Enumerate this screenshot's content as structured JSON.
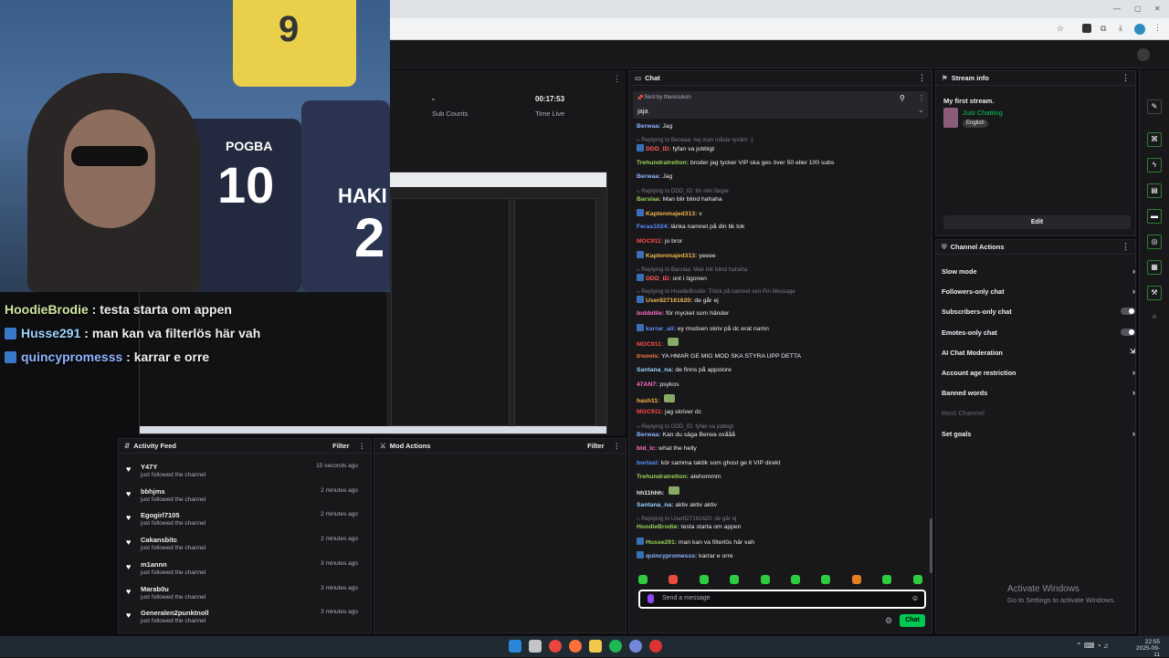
{
  "stats": {
    "subs_value": "-",
    "subs_label": "Sub Counts",
    "time_value": "00:17:53",
    "time_label": "Time Live"
  },
  "webcam": {
    "jersey_name_1": "POGBA",
    "jersey_num_1": "10",
    "jersey_name_2": "HAKI",
    "jersey_num_2": "2",
    "jersey_top_num": "9"
  },
  "overlay_chat": [
    {
      "user": "HoodieBrodie",
      "msg": ": testa starta om appen",
      "badge": false
    },
    {
      "user": "Husse291",
      "msg": ": man kan va filterlös här vah",
      "badge": true
    },
    {
      "user": "quincypromesss",
      "msg": ": karrar e orre",
      "badge": true
    }
  ],
  "activity": {
    "title": "Activity Feed",
    "filter": "Filter",
    "items": [
      {
        "name": "Y47Y",
        "action": "just followed the channel",
        "time": "15 seconds ago"
      },
      {
        "name": "bbhjms",
        "action": "just followed the channel",
        "time": "2 minutes ago"
      },
      {
        "name": "Egogirl7105",
        "action": "just followed the channel",
        "time": "2 minutes ago"
      },
      {
        "name": "Cakansbitc",
        "action": "just followed the channel",
        "time": "2 minutes ago"
      },
      {
        "name": "m1annn",
        "action": "just followed the channel",
        "time": "3 minutes ago"
      },
      {
        "name": "Marab0u",
        "action": "just followed the channel",
        "time": "3 minutes ago"
      },
      {
        "name": "Generalen2punktnoll",
        "action": "just followed the channel",
        "time": "3 minutes ago"
      }
    ]
  },
  "mod": {
    "title": "Mod Actions",
    "filter": "Filter"
  },
  "chat": {
    "title": "Chat",
    "pinned_label": "Sent by theresukon",
    "pinned_msg": "jaja",
    "lines": [
      {
        "name": "Berwaa:",
        "msg": "Jag",
        "color": "#8fb4ff",
        "badge": false
      },
      {
        "rep": "Replying to Berwaa: nej man måste tyvärrr :("
      },
      {
        "name": "DDD_ID:",
        "msg": "fyfan va jobbigt",
        "color": "#ff5b5b",
        "badge": true
      },
      {
        "name": "Trehundratretton:",
        "msg": "broder jag tycker VIP ska ges över 50 eller 100 subs",
        "color": "#9ad35a",
        "badge": false
      },
      {
        "name": "Berwaa:",
        "msg": "Jag",
        "color": "#8fb4ff",
        "badge": false
      },
      {
        "rep": "Replying to DDD_ID: för mkt färger"
      },
      {
        "name": "Barslaa:",
        "msg": "Man blir blind hahaha",
        "color": "#9ad35a",
        "badge": false
      },
      {
        "name": "Kaptenmajed313:",
        "msg": "v",
        "color": "#f1b44c",
        "badge": true
      },
      {
        "name": "Feras1024:",
        "msg": "länka namnet på din tik tok",
        "color": "#5b8fff",
        "badge": false
      },
      {
        "name": "MOC911:",
        "msg": "jo bror",
        "color": "#ff4b4b",
        "badge": false
      },
      {
        "name": "Kaptenmajed313:",
        "msg": "yeeee",
        "color": "#f1b44c",
        "badge": true
      },
      {
        "rep": "Replying to Barslaa: Man blir blind hahaha"
      },
      {
        "name": "DDD_ID:",
        "msg": "ont i ögonen",
        "color": "#ff5b5b",
        "badge": true
      },
      {
        "rep": "Replying to HoodieBrodie: Tritck på namnet sen Pin Message"
      },
      {
        "name": "User827161620:",
        "msg": "de går ej",
        "color": "#f1b44c",
        "badge": true
      },
      {
        "name": "bubbillie:",
        "msg": "för mycket som händer",
        "color": "#ff6ec7",
        "badge": false
      },
      {
        "name": "karrar_ali:",
        "msg": "ey modsen skriv på dc erat namn",
        "color": "#5b8fff",
        "badge": true
      },
      {
        "name": "MOC911:",
        "msg": "",
        "color": "#ff4b4b",
        "badge": false
      },
      {
        "name": "trooois:",
        "msg": "YA HMAR GE MIG MOD SKA STYRA UPP DETTA",
        "color": "#ff7a3d",
        "badge": false
      },
      {
        "name": "Santana_na:",
        "msg": "de finns på appstore",
        "color": "#9ad3ff",
        "badge": false
      },
      {
        "name": "47AN7:",
        "msg": "psykos",
        "color": "#ff6ec7",
        "badge": false
      },
      {
        "name": "hash11:",
        "msg": "",
        "color": "#ffb347",
        "badge": false
      },
      {
        "name": "MOC911:",
        "msg": "jag skriver dc",
        "color": "#ff4b4b",
        "badge": false
      },
      {
        "rep": "Replying to DDD_ID: fyfan va jobbigt"
      },
      {
        "name": "Berwaa:",
        "msg": "Kan du säga Berwa oxååå",
        "color": "#8fb4ff",
        "badge": false
      },
      {
        "name": "btd_lc:",
        "msg": "what the helly",
        "color": "#ff6ec7",
        "badge": false
      },
      {
        "name": "bortasl:",
        "msg": "kör samma taktik som ghost ge it VIP direkt",
        "color": "#5b8fff",
        "badge": false
      },
      {
        "name": "Trehundratretton:",
        "msg": "alehommm",
        "color": "#9ad35a",
        "badge": false
      },
      {
        "name": "hh11hhh:",
        "msg": "",
        "color": "#efeff1",
        "badge": false
      },
      {
        "name": "Santana_na:",
        "msg": "aktiv aktiv aktiv",
        "color": "#9ad3ff",
        "badge": false
      },
      {
        "rep": "Replying to User827161620: de går ej"
      },
      {
        "name": "HoodieBrodie:",
        "msg": "testa starta om appen",
        "color": "#9ad35a",
        "badge": false
      },
      {
        "name": "Husse291:",
        "msg": "man kan va filterlös här vah",
        "color": "#9ad35a",
        "badge": true
      },
      {
        "name": "quincypromesss:",
        "msg": "karrar e orre",
        "color": "#8fb4ff",
        "badge": true
      }
    ],
    "input_placeholder": "Send a message",
    "send_label": "Chat"
  },
  "stream_info": {
    "title": "Stream info",
    "stream_title": "My first stream.",
    "category": "Just Chatting",
    "language": "English",
    "edit": "Edit"
  },
  "channel_actions": {
    "title": "Channel Actions",
    "items": [
      {
        "label": "Slow mode",
        "ctrl": "arrow"
      },
      {
        "label": "Followers-only chat",
        "ctrl": "arrow"
      },
      {
        "label": "Subscribers-only chat",
        "ctrl": "toggle"
      },
      {
        "label": "Emotes-only chat",
        "ctrl": "toggle"
      },
      {
        "label": "AI Chat Moderation",
        "ctrl": "link"
      },
      {
        "label": "Account age restriction",
        "ctrl": "arrow"
      },
      {
        "label": "Banned words",
        "ctrl": "arrow"
      },
      {
        "label": "Host Channel",
        "ctrl": "none",
        "disabled": true
      },
      {
        "label": "Set goals",
        "ctrl": "arrow"
      }
    ]
  },
  "watermark": {
    "line1": "Activate Windows",
    "line2": "Go to Settings to activate Windows."
  },
  "clock": {
    "time": "22:55",
    "date": "2025-09-11"
  },
  "colors": {
    "accent": "#00c853",
    "bg": "#0e0e10",
    "panel": "#18181b"
  }
}
